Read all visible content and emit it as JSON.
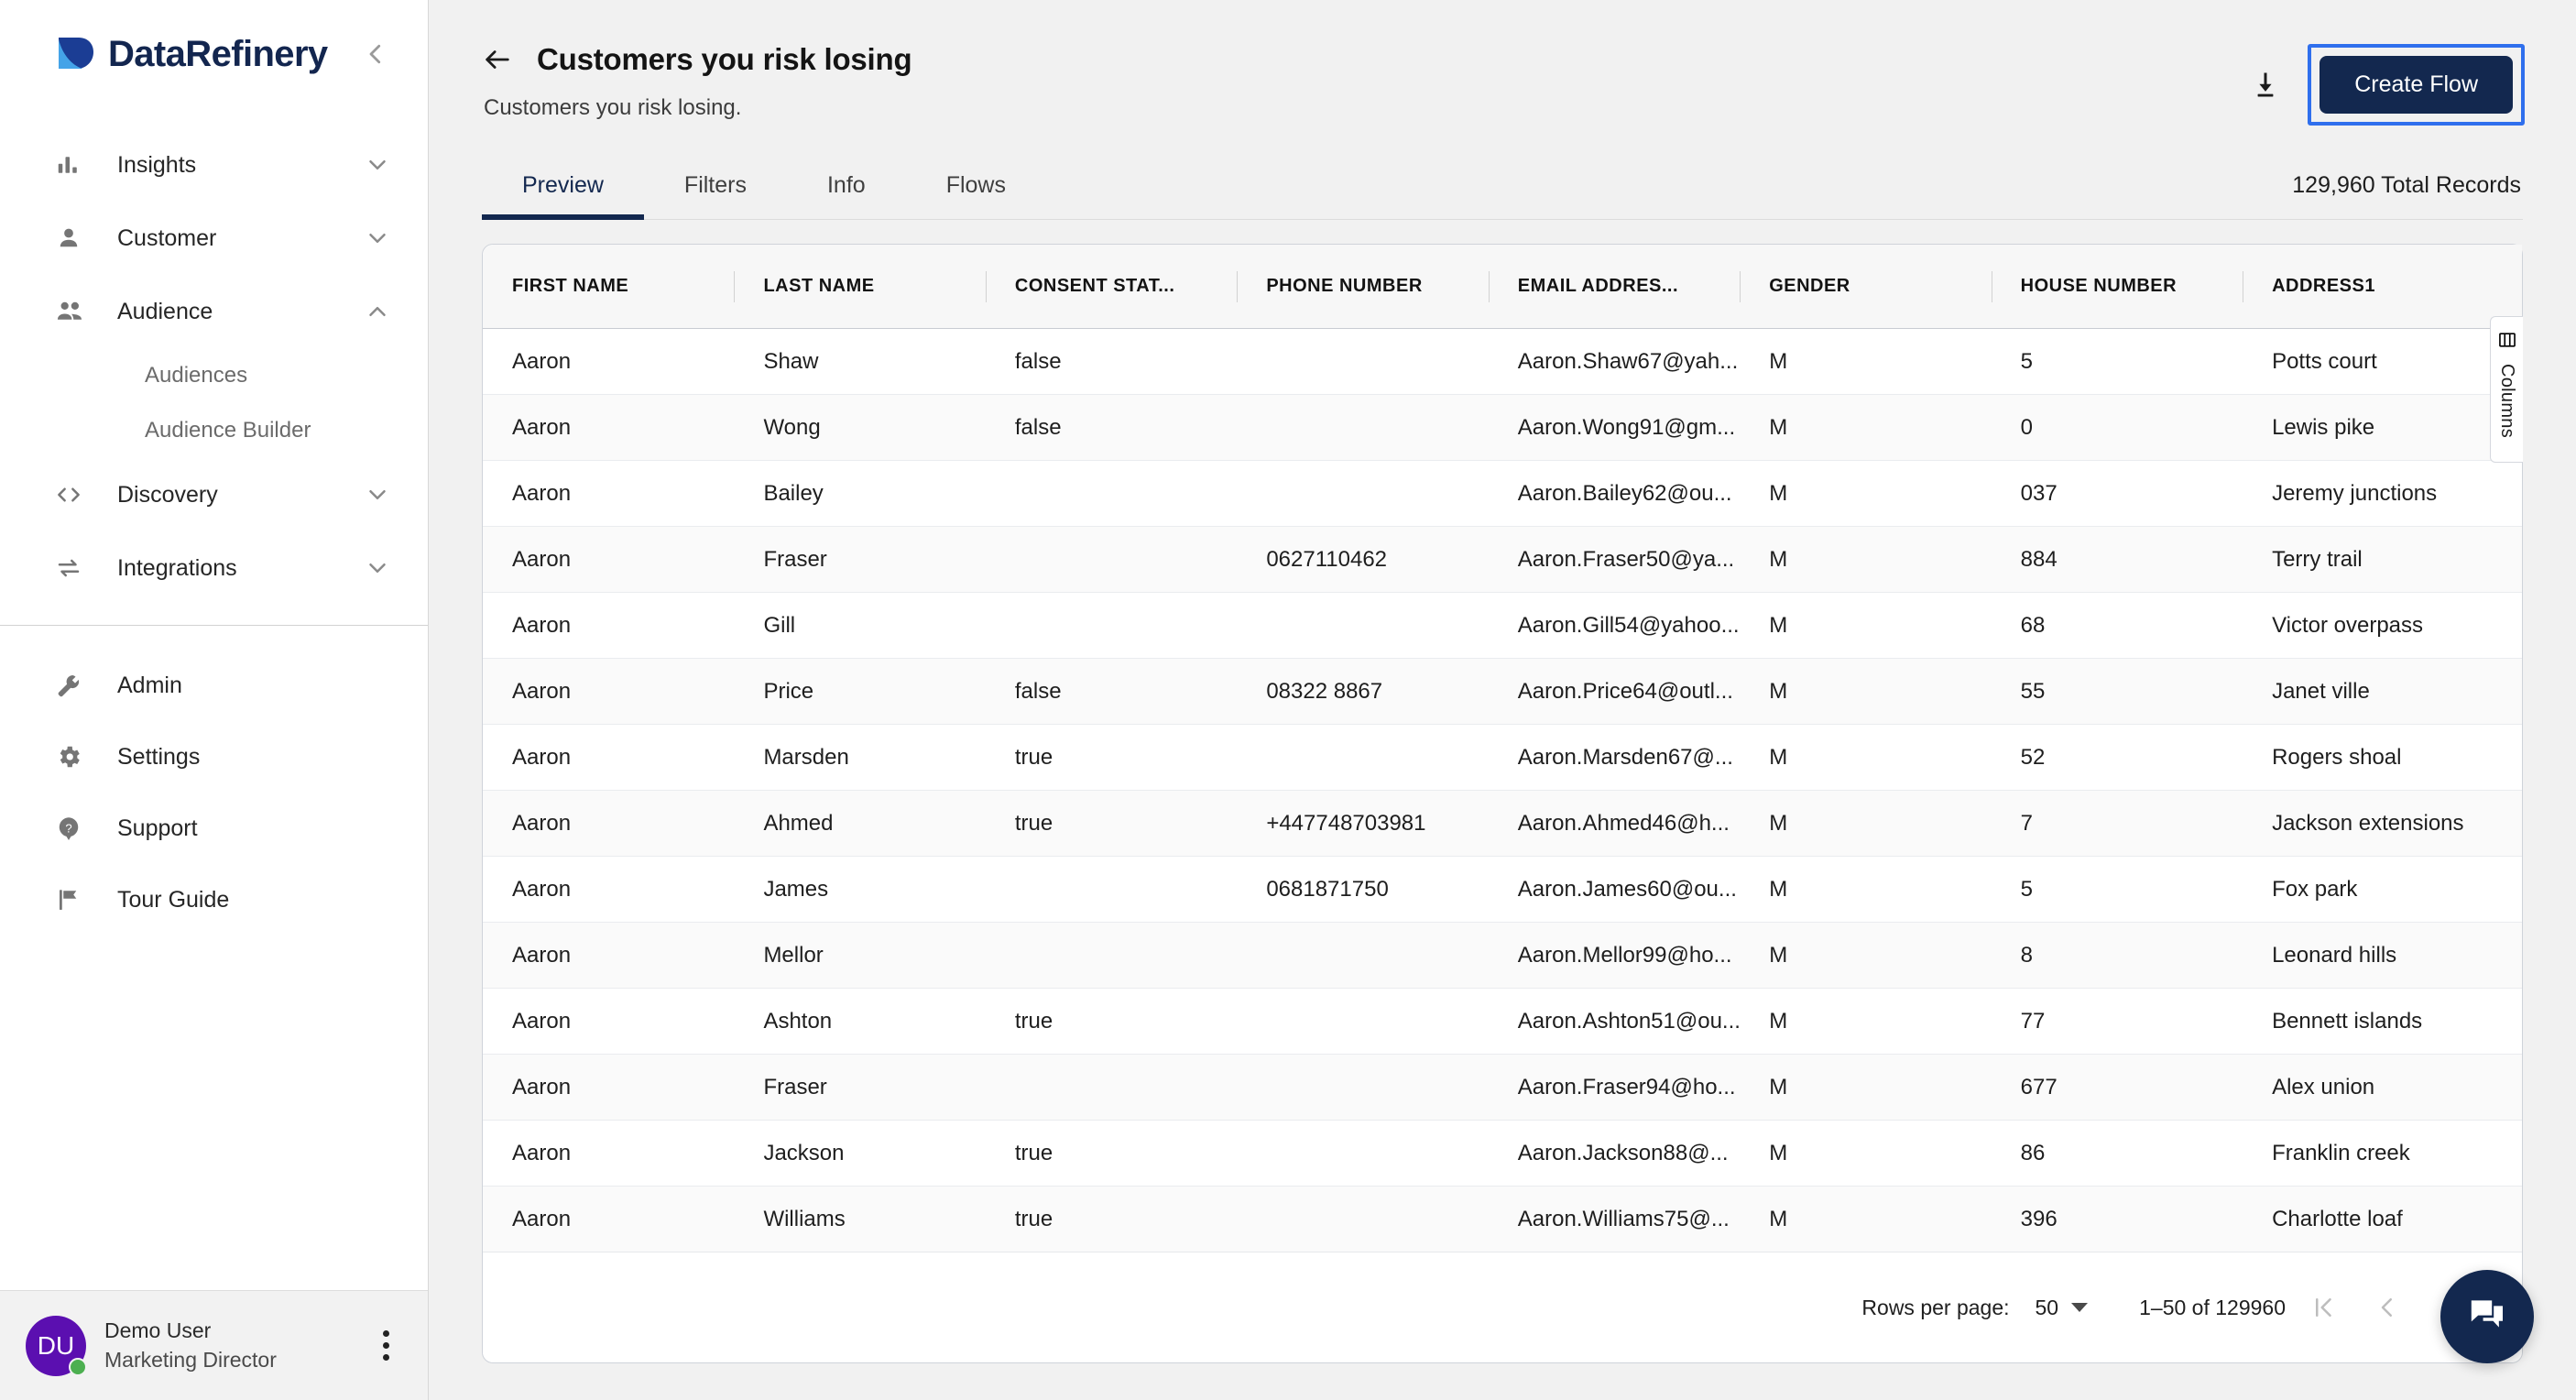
{
  "brand": {
    "name": "DataRefinery",
    "collapse_icon": "chevron-left-icon"
  },
  "sidebar": {
    "nav": [
      {
        "label": "Insights",
        "icon": "bar-chart-icon",
        "chevron": "chevron-down-icon",
        "expanded": false
      },
      {
        "label": "Customer",
        "icon": "person-icon",
        "chevron": "chevron-down-icon",
        "expanded": false
      },
      {
        "label": "Audience",
        "icon": "people-icon",
        "chevron": "chevron-up-icon",
        "expanded": true
      },
      {
        "label": "Discovery",
        "icon": "code-brackets-icon",
        "chevron": "chevron-down-icon",
        "expanded": false
      },
      {
        "label": "Integrations",
        "icon": "swap-arrows-icon",
        "chevron": "chevron-down-icon",
        "expanded": false
      }
    ],
    "sub_items": [
      {
        "label": "Audiences"
      },
      {
        "label": "Audience Builder"
      }
    ],
    "bottom_nav": [
      {
        "label": "Admin",
        "icon": "wrench-icon"
      },
      {
        "label": "Settings",
        "icon": "gear-icon"
      },
      {
        "label": "Support",
        "icon": "help-circle-icon"
      },
      {
        "label": "Tour Guide",
        "icon": "flag-icon"
      }
    ],
    "user": {
      "initials": "DU",
      "name": "Demo User",
      "role": "Marketing Director",
      "avatar_color": "#5b0fb0",
      "presence_color": "#4caf50",
      "more_icon": "kebab-menu-icon"
    }
  },
  "header": {
    "back_icon": "arrow-left-icon",
    "title": "Customers you risk losing",
    "subtitle": "Customers you risk losing.",
    "download_icon": "download-icon",
    "create_flow_label": "Create Flow",
    "create_flow_bg": "#13284f",
    "focus_ring_color": "#2f6fed"
  },
  "tabs": {
    "items": [
      {
        "label": "Preview",
        "active": true
      },
      {
        "label": "Filters",
        "active": false
      },
      {
        "label": "Info",
        "active": false
      },
      {
        "label": "Flows",
        "active": false
      }
    ],
    "total_records": "129,960 Total Records",
    "accent": "#13284f"
  },
  "columns_tab": {
    "label": "Columns",
    "icon": "table-columns-icon"
  },
  "table": {
    "columns": [
      "FIRST NAME",
      "LAST NAME",
      "CONSENT STAT...",
      "PHONE NUMBER",
      "EMAIL ADDRES...",
      "GENDER",
      "HOUSE NUMBER",
      "ADDRESS1"
    ],
    "rows": [
      [
        "Aaron",
        "Shaw",
        "false",
        "",
        "Aaron.Shaw67@yah...",
        "M",
        "5",
        "Potts court"
      ],
      [
        "Aaron",
        "Wong",
        "false",
        "",
        "Aaron.Wong91@gm...",
        "M",
        "0",
        "Lewis pike"
      ],
      [
        "Aaron",
        "Bailey",
        "",
        "",
        "Aaron.Bailey62@ou...",
        "M",
        "037",
        "Jeremy junctions"
      ],
      [
        "Aaron",
        "Fraser",
        "",
        "0627110462",
        "Aaron.Fraser50@ya...",
        "M",
        "884",
        "Terry trail"
      ],
      [
        "Aaron",
        "Gill",
        "",
        "",
        "Aaron.Gill54@yahoo...",
        "M",
        "68",
        "Victor overpass"
      ],
      [
        "Aaron",
        "Price",
        "false",
        "08322 8867",
        "Aaron.Price64@outl...",
        "M",
        "55",
        "Janet ville"
      ],
      [
        "Aaron",
        "Marsden",
        "true",
        "",
        "Aaron.Marsden67@...",
        "M",
        "52",
        "Rogers shoal"
      ],
      [
        "Aaron",
        "Ahmed",
        "true",
        "+447748703981",
        "Aaron.Ahmed46@h...",
        "M",
        "7",
        "Jackson extensions"
      ],
      [
        "Aaron",
        "James",
        "",
        "0681871750",
        "Aaron.James60@ou...",
        "M",
        "5",
        "Fox park"
      ],
      [
        "Aaron",
        "Mellor",
        "",
        "",
        "Aaron.Mellor99@ho...",
        "M",
        "8",
        "Leonard hills"
      ],
      [
        "Aaron",
        "Ashton",
        "true",
        "",
        "Aaron.Ashton51@ou...",
        "M",
        "77",
        "Bennett islands"
      ],
      [
        "Aaron",
        "Fraser",
        "",
        "",
        "Aaron.Fraser94@ho...",
        "M",
        "677",
        "Alex union"
      ],
      [
        "Aaron",
        "Jackson",
        "true",
        "",
        "Aaron.Jackson88@...",
        "M",
        "86",
        "Franklin creek"
      ],
      [
        "Aaron",
        "Williams",
        "true",
        "",
        "Aaron.Williams75@...",
        "M",
        "396",
        "Charlotte loaf"
      ]
    ]
  },
  "pagination": {
    "rows_per_page_label": "Rows per page:",
    "rows_per_page_value": "50",
    "range_label": "1–50 of 129960",
    "first_icon": "first-page-icon",
    "prev_icon": "chevron-left-icon",
    "next_icon": "chevron-right-icon",
    "first_enabled": false,
    "prev_enabled": false,
    "next_enabled": true
  },
  "chat": {
    "icon": "chat-bubbles-icon",
    "bg": "#13284f"
  }
}
